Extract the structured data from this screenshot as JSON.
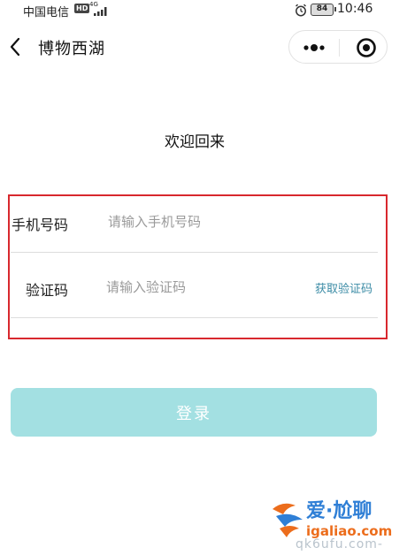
{
  "status_bar": {
    "carrier": "中国电信",
    "hd_badge": "HD",
    "network_type": "4G",
    "battery": "84",
    "time": "10:46",
    "icons": [
      "hd-icon",
      "signal-icon",
      "alarm-icon",
      "battery-icon"
    ]
  },
  "nav": {
    "title": "博物西湖",
    "back_icon": "chevron-left-icon",
    "more_icon": "more-dots-icon",
    "close_icon": "target-close-icon"
  },
  "welcome": "欢迎回来",
  "form": {
    "phone_label": "手机号码",
    "phone_placeholder": "请输入手机号码",
    "phone_value": "",
    "code_label": "验证码",
    "code_placeholder": "请输入验证码",
    "code_value": "",
    "get_code_label": "获取验证码"
  },
  "login_button": "登录",
  "watermark": {
    "title": "爱·尬聊",
    "domain": "igaliao.com",
    "sub": "qk6ufu.com-"
  },
  "colors": {
    "highlight_border": "#d8282e",
    "link": "#3c8ca6",
    "login_button_bg": "#a3e0e2",
    "login_button_text": "#ffffff",
    "placeholder": "#9a9a9a"
  }
}
